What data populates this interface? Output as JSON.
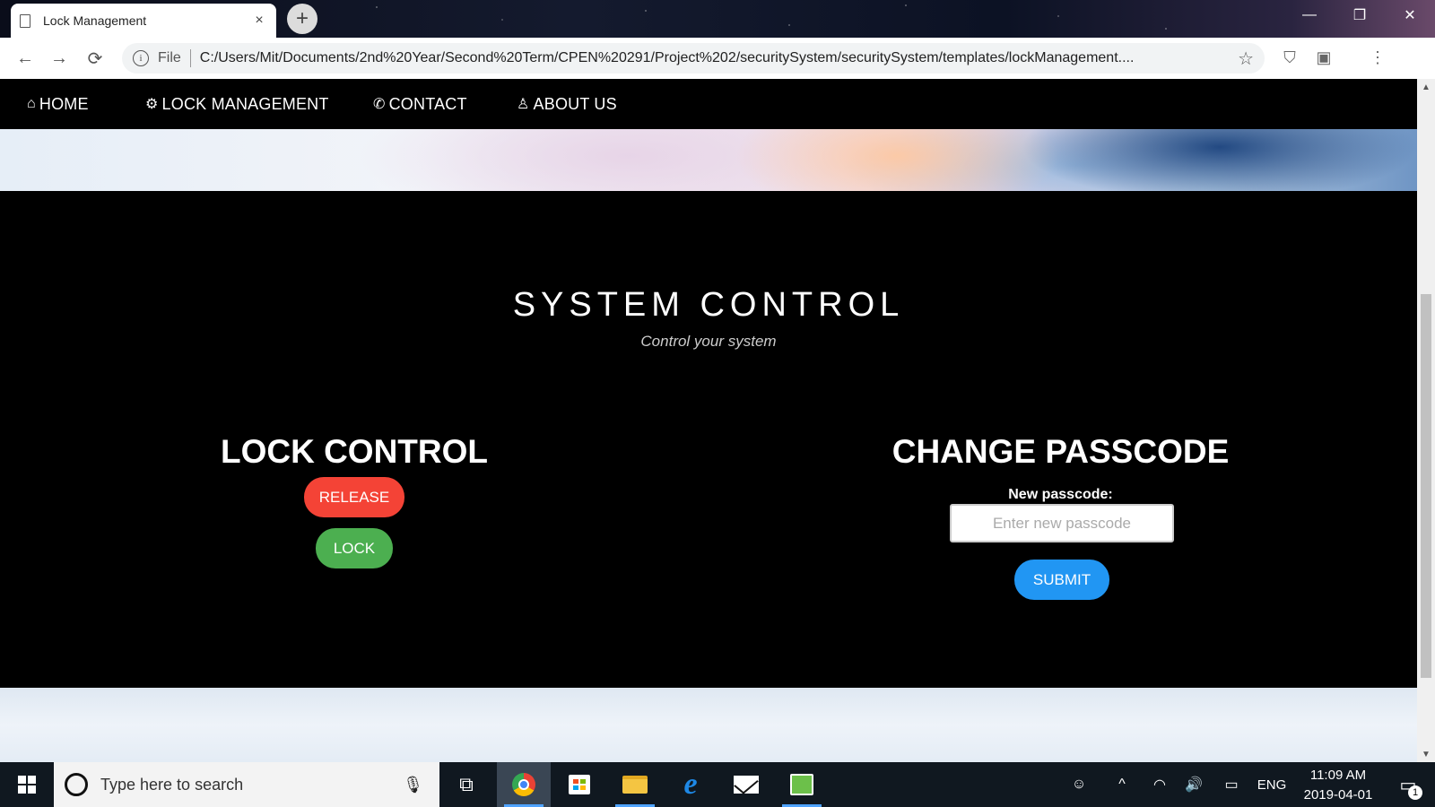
{
  "browser": {
    "tab_title": "Lock Management",
    "tab_close": "×",
    "new_tab": "+",
    "window_controls": {
      "minimize": "—",
      "restore": "❐",
      "close": "✕"
    },
    "nav": {
      "back": "←",
      "forward": "→",
      "reload": "⟳"
    },
    "omnibox": {
      "info_icon": "i",
      "scheme": "File",
      "url": "C:/Users/Mit/Documents/2nd%20Year/Second%20Term/CPEN%20291/Project%202/securitySystem/securitySystem/templates/lockManagement....",
      "bookmark_icon": "☆"
    }
  },
  "site_nav": {
    "items": [
      {
        "icon": "⌂",
        "label": "HOME"
      },
      {
        "icon": "⚙",
        "label": "LOCK MANAGEMENT"
      },
      {
        "icon": "✆",
        "label": "CONTACT"
      },
      {
        "icon": "♙",
        "label": "ABOUT US"
      }
    ]
  },
  "main": {
    "title": "SYSTEM CONTROL",
    "subtitle": "Control your system",
    "lock_control": {
      "heading": "LOCK CONTROL",
      "release_label": "RELEASE",
      "lock_label": "LOCK"
    },
    "change_passcode": {
      "heading": "CHANGE PASSCODE",
      "field_label": "New passcode:",
      "field_value": "",
      "field_placeholder": "Enter new passcode",
      "submit_label": "SUBMIT"
    }
  },
  "colors": {
    "release": "#f44336",
    "lock": "#4caf50",
    "submit": "#2196f3"
  },
  "taskbar": {
    "search_placeholder": "Type here to search",
    "mic_icon": "🎙",
    "task_view_icon": "⧉",
    "tray": {
      "people_icon": "☺",
      "chevron_icon": "^",
      "wifi_icon": "◠",
      "volume_icon": "🔊",
      "battery_icon": "▭",
      "language": "ENG"
    },
    "time": "11:09 AM",
    "date": "2019-04-01",
    "notification_count": "1"
  },
  "scrollbar": {
    "up": "▲",
    "down": "▼"
  }
}
